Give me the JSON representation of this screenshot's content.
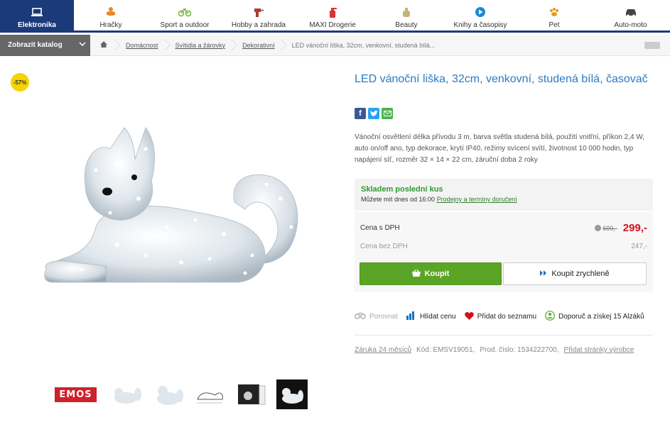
{
  "nav": {
    "items": [
      {
        "label": "Elektronika",
        "icon": "laptop-icon"
      },
      {
        "label": "Hračky",
        "icon": "toy-icon"
      },
      {
        "label": "Sport a outdoor",
        "icon": "bicycle-icon"
      },
      {
        "label": "Hobby a zahrada",
        "icon": "drill-icon"
      },
      {
        "label": "MAXI Drogerie",
        "icon": "spray-bottle-icon"
      },
      {
        "label": "Beauty",
        "icon": "perfume-icon"
      },
      {
        "label": "Knihy a časopisy",
        "icon": "play-circle-icon"
      },
      {
        "label": "Pet",
        "icon": "paw-icon"
      },
      {
        "label": "Auto-moto",
        "icon": "car-icon"
      }
    ]
  },
  "catalog": {
    "label": "Zobrazit katalog"
  },
  "breadcrumb": {
    "items": [
      "Domácnost",
      "Svítidla a žárovky",
      "Dekorativní"
    ],
    "current": "LED vánoční liška, 32cm, venkovní, studená bílá..."
  },
  "product": {
    "discount": "-57%",
    "title": "LED vánoční liška, 32cm, venkovní, studená bílá, časovač",
    "description": "Vánoční osvětlení délka přívodu 3 m, barva světla studená bílá, použití vnitřní, příkon 2,4 W, auto on/off ano, typ dekorace, krytí IP40, režimy svícení svítí, životnost 10 000 hodin, typ napájení síť, rozměr 32 × 14 × 22 cm, záruční doba 2 roky",
    "brand_thumb": "EMOS"
  },
  "stock": {
    "title": "Skladem poslední kus",
    "sub_prefix": "Můžete mít dnes od 16:00",
    "sub_link": "Prodejny a termíny doručení"
  },
  "price": {
    "with_vat_label": "Cena s DPH",
    "old_price": "699,-",
    "new_price": "299,-",
    "without_vat_label": "Cena bez DPH",
    "without_vat": "247,-"
  },
  "buttons": {
    "buy": "Koupit",
    "fast_buy": "Koupit zrychleně"
  },
  "actions": {
    "compare": "Porovnat",
    "watch": "Hlídat cenu",
    "wishlist": "Přidat do seznamu",
    "recommend": "Doporuč a získej 15 Alzáků"
  },
  "meta": {
    "warranty": "Záruka 24 měsíců",
    "code": "Kód: EMSV19051,",
    "prod_number": "Prod. číslo: 1534222700,",
    "add_page": "Přidat stránky výrobce"
  },
  "colors": {
    "brand_dark": "#1a3a7a",
    "title_blue": "#2b7bc4",
    "buy_green": "#5aa526",
    "price_red": "#d0121b"
  }
}
